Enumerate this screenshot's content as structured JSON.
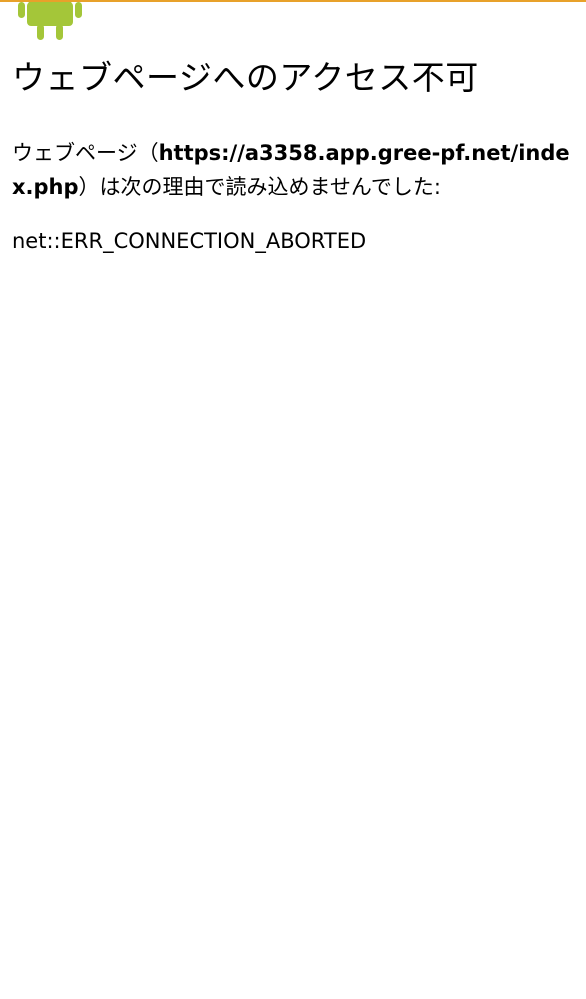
{
  "header": {
    "logo_icon": "android-robot-icon",
    "accent_color": "#e8a12a",
    "logo_color": "#a4c639"
  },
  "error": {
    "title": "ウェブページへのアクセス不可",
    "message_prefix": "ウェブページ（",
    "url": "https://a3358.app.gree-pf.net/index.php",
    "message_suffix": "）は次の理由で読み込めませんでした:",
    "code": "net::ERR_CONNECTION_ABORTED"
  }
}
